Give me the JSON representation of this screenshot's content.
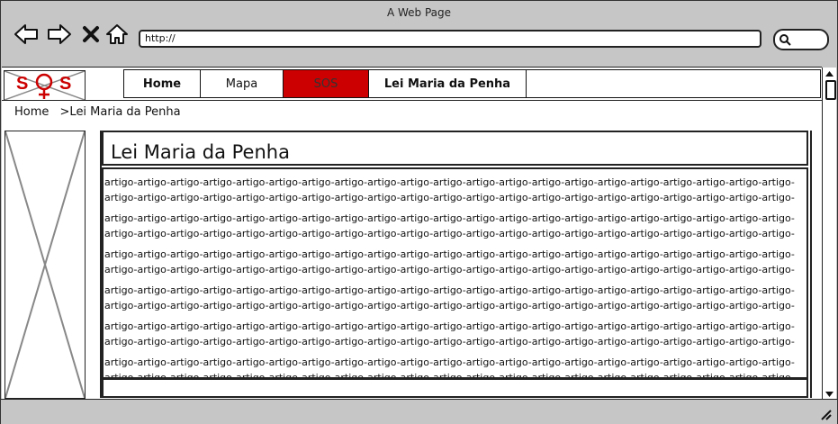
{
  "browser": {
    "title": "A Web Page",
    "url": "http://"
  },
  "logo": {
    "text_left": "S",
    "text_right": "S"
  },
  "nav": {
    "tabs": [
      {
        "label": "Home",
        "bold": true,
        "active": false
      },
      {
        "label": "Mapa",
        "bold": false,
        "active": false
      },
      {
        "label": "SOS",
        "bold": false,
        "active": true
      },
      {
        "label": "Lei Maria da Penha",
        "bold": true,
        "active": false
      }
    ]
  },
  "breadcrumb": {
    "home": "Home",
    "current": ">Lei Maria da Penha"
  },
  "article": {
    "title": "Lei Maria da Penha",
    "paragraphs": [
      [
        "artigo-artigo-artigo-artigo-artigo-artigo-artigo-artigo-artigo-artigo-artigo-artigo-artigo-artigo-artigo-artigo-artigo-artigo-artigo-artigo-artigo-",
        "artigo-artigo-artigo-artigo-artigo-artigo-artigo-artigo-artigo-artigo-artigo-artigo-artigo-artigo-artigo-artigo-artigo-artigo-artigo-artigo-artigo-"
      ],
      [
        "artigo-artigo-artigo-artigo-artigo-artigo-artigo-artigo-artigo-artigo-artigo-artigo-artigo-artigo-artigo-artigo-artigo-artigo-artigo-artigo-artigo-",
        "artigo-artigo-artigo-artigo-artigo-artigo-artigo-artigo-artigo-artigo-artigo-artigo-artigo-artigo-artigo-artigo-artigo-artigo-artigo-artigo-artigo-"
      ],
      [
        "artigo-artigo-artigo-artigo-artigo-artigo-artigo-artigo-artigo-artigo-artigo-artigo-artigo-artigo-artigo-artigo-artigo-artigo-artigo-artigo-artigo-",
        "artigo-artigo-artigo-artigo-artigo-artigo-artigo-artigo-artigo-artigo-artigo-artigo-artigo-artigo-artigo-artigo-artigo-artigo-artigo-artigo-artigo-"
      ],
      [
        "artigo-artigo-artigo-artigo-artigo-artigo-artigo-artigo-artigo-artigo-artigo-artigo-artigo-artigo-artigo-artigo-artigo-artigo-artigo-artigo-artigo-",
        "artigo-artigo-artigo-artigo-artigo-artigo-artigo-artigo-artigo-artigo-artigo-artigo-artigo-artigo-artigo-artigo-artigo-artigo-artigo-artigo-artigo-"
      ],
      [
        "artigo-artigo-artigo-artigo-artigo-artigo-artigo-artigo-artigo-artigo-artigo-artigo-artigo-artigo-artigo-artigo-artigo-artigo-artigo-artigo-artigo-",
        "artigo-artigo-artigo-artigo-artigo-artigo-artigo-artigo-artigo-artigo-artigo-artigo-artigo-artigo-artigo-artigo-artigo-artigo-artigo-artigo-artigo-"
      ],
      [
        "artigo-artigo-artigo-artigo-artigo-artigo-artigo-artigo-artigo-artigo-artigo-artigo-artigo-artigo-artigo-artigo-artigo-artigo-artigo-artigo-artigo-",
        "artigo-artigo-artigo-artigo-artigo-artigo-artigo-artigo-artigo-artigo-artigo-artigo-artigo-artigo-artigo-artigo-artigo-artigo-artigo-artigo-artigo-"
      ]
    ]
  },
  "colors": {
    "accent": "#cc0000",
    "chrome": "#c6c6c6"
  }
}
